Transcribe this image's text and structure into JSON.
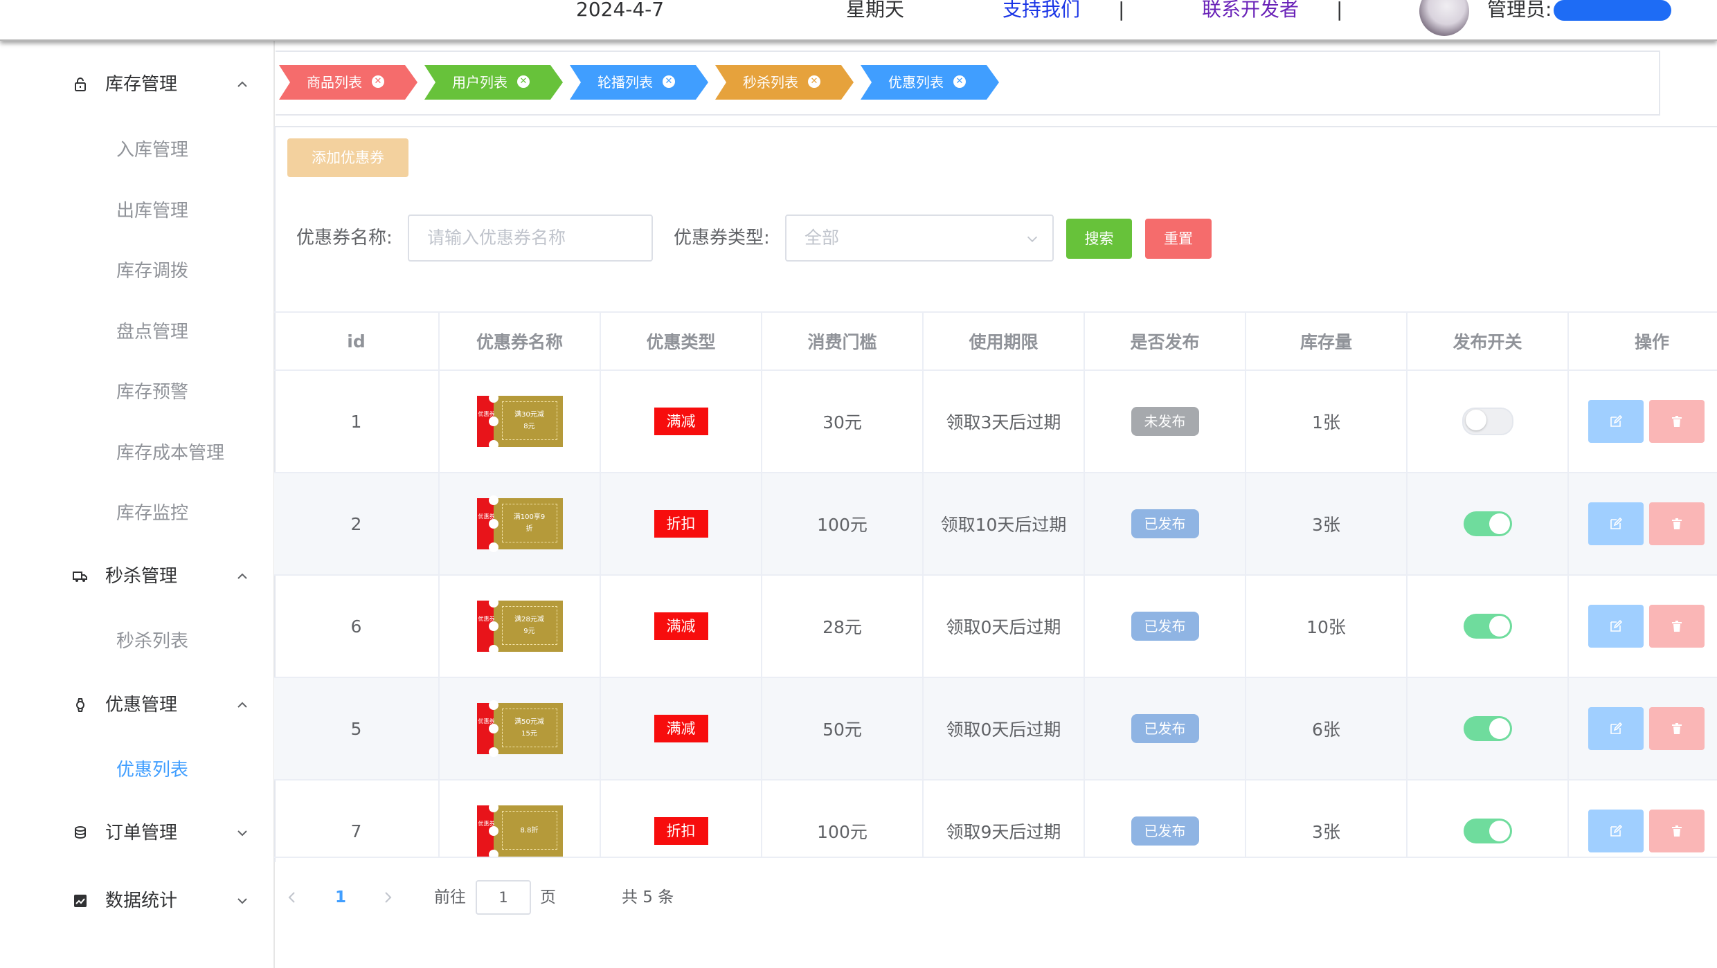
{
  "header": {
    "date": "2024-4-7",
    "weekday": "星期天",
    "support_link": "支持我们",
    "separator": "|",
    "developer_link": "联系开发者",
    "admin_label": "管理员:"
  },
  "sidebar": {
    "groups": [
      {
        "title": "库存管理",
        "icon": "lock-icon",
        "expanded": true,
        "items": [
          "入库管理",
          "出库管理",
          "库存调拨",
          "盘点管理",
          "库存预警",
          "库存成本管理",
          "库存监控"
        ]
      },
      {
        "title": "秒杀管理",
        "icon": "truck-icon",
        "expanded": true,
        "items": [
          "秒杀列表"
        ]
      },
      {
        "title": "优惠管理",
        "icon": "watch-icon",
        "expanded": true,
        "items": [
          "优惠列表"
        ],
        "active_item": "优惠列表"
      },
      {
        "title": "订单管理",
        "icon": "coins-icon",
        "expanded": false,
        "items": []
      },
      {
        "title": "数据统计",
        "icon": "chart-icon",
        "expanded": false,
        "items": []
      }
    ]
  },
  "tags": [
    {
      "label": "商品列表",
      "color": "#f56c6c"
    },
    {
      "label": "用户列表",
      "color": "#67c23a"
    },
    {
      "label": "轮播列表",
      "color": "#409eff"
    },
    {
      "label": "秒杀列表",
      "color": "#e6a23c"
    },
    {
      "label": "优惠列表",
      "color": "#409eff"
    }
  ],
  "toolbar": {
    "add_label": "添加优惠券"
  },
  "search": {
    "name_label": "优惠券名称:",
    "name_placeholder": "请输入优惠券名称",
    "type_label": "优惠券类型:",
    "type_value": "全部",
    "search_label": "搜索",
    "reset_label": "重置"
  },
  "table": {
    "columns": [
      "id",
      "优惠券名称",
      "优惠类型",
      "消费门槛",
      "使用期限",
      "是否发布",
      "库存量",
      "发布开关",
      "操作"
    ],
    "coupon_side_text": "优惠券",
    "rows": [
      {
        "id": "1",
        "coupon_line1": "满30元减",
        "coupon_line2": "8元",
        "type": "满减",
        "threshold": "30元",
        "period": "领取3天后过期",
        "published": "未发布",
        "stock": "1张",
        "switch_on": false
      },
      {
        "id": "2",
        "coupon_line1": "满100享9",
        "coupon_line2": "折",
        "type": "折扣",
        "threshold": "100元",
        "period": "领取10天后过期",
        "published": "已发布",
        "stock": "3张",
        "switch_on": true
      },
      {
        "id": "6",
        "coupon_line1": "满28元减",
        "coupon_line2": "9元",
        "type": "满减",
        "threshold": "28元",
        "period": "领取0天后过期",
        "published": "已发布",
        "stock": "10张",
        "switch_on": true
      },
      {
        "id": "5",
        "coupon_line1": "满50元减",
        "coupon_line2": "15元",
        "type": "满减",
        "threshold": "50元",
        "period": "领取0天后过期",
        "published": "已发布",
        "stock": "6张",
        "switch_on": true
      },
      {
        "id": "7",
        "coupon_line1": "8.8折",
        "coupon_line2": "",
        "type": "折扣",
        "threshold": "100元",
        "period": "领取9天后过期",
        "published": "已发布",
        "stock": "3张",
        "switch_on": true
      }
    ]
  },
  "pagination": {
    "current_page": "1",
    "goto_label": "前往",
    "goto_value": "1",
    "page_suffix": "页",
    "total": "共 5 条"
  },
  "colors": {
    "primary": "#409eff",
    "success": "#67c23a",
    "danger": "#f56c6c",
    "warning": "#e6a23c",
    "switch_on": "#6fdc9d",
    "switch_off": "#dcdfe6",
    "edit_button": "#a0cfff",
    "delete_button": "#fab6b6"
  }
}
